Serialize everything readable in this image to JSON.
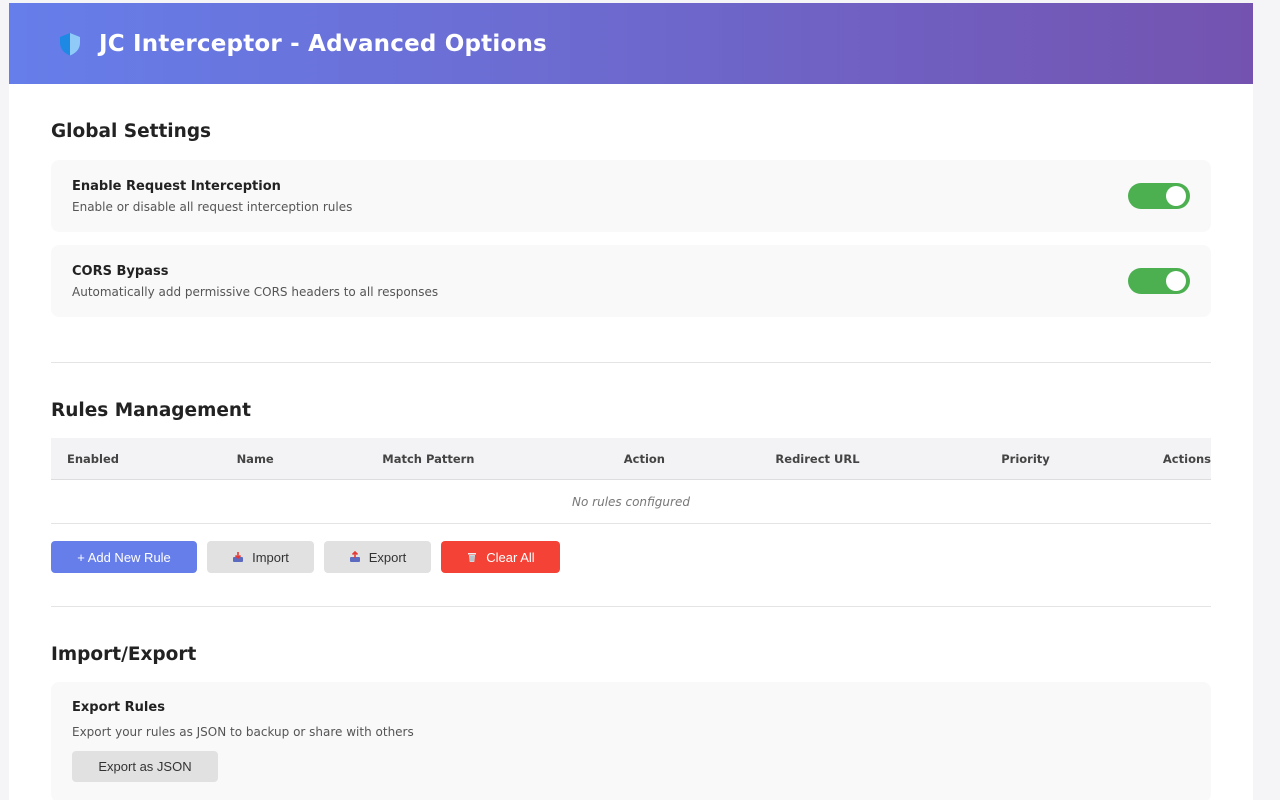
{
  "header": {
    "title": "JC Interceptor - Advanced Options",
    "icon": "shield-icon",
    "gradient_start": "#667eea",
    "gradient_end": "#7453b0"
  },
  "global_settings": {
    "title": "Global Settings",
    "items": [
      {
        "title": "Enable Request Interception",
        "description": "Enable or disable all request interception rules",
        "enabled": true
      },
      {
        "title": "CORS Bypass",
        "description": "Automatically add permissive CORS headers to all responses",
        "enabled": true
      }
    ]
  },
  "rules": {
    "title": "Rules Management",
    "columns": [
      "Enabled",
      "Name",
      "Match Pattern",
      "Action",
      "Redirect URL",
      "Priority",
      "Actions"
    ],
    "empty_message": "No rules configured",
    "buttons": {
      "add": "+ Add New Rule",
      "import": "Import",
      "export": "Export",
      "clear": "Clear All"
    }
  },
  "import_export": {
    "title": "Import/Export",
    "export_card": {
      "title": "Export Rules",
      "description": "Export your rules as JSON to backup or share with others",
      "button": "Export as JSON"
    }
  },
  "colors": {
    "accent": "#667eea",
    "toggle_on": "#4caf50",
    "danger": "#f44336"
  }
}
